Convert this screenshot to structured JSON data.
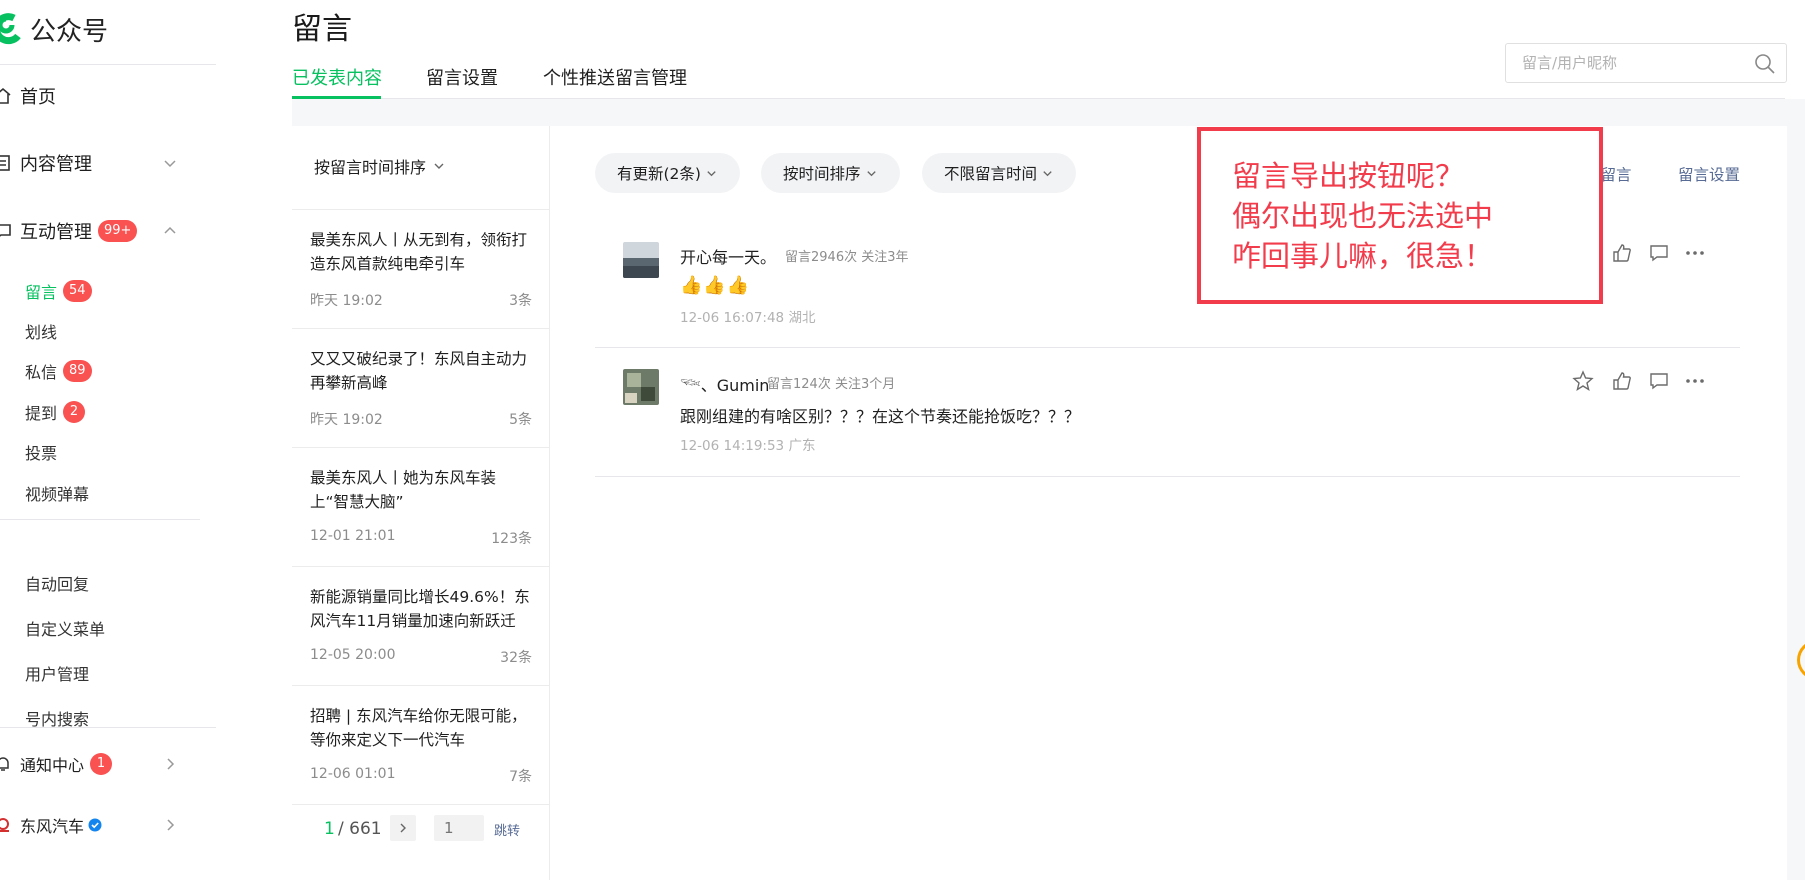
{
  "brand": {
    "name": "公众号"
  },
  "sidebar": {
    "home": "首页",
    "content_mgmt": "内容管理",
    "interaction_mgmt": "互动管理",
    "interaction_badge": "99+",
    "sub_items": [
      {
        "label": "留言",
        "badge": "54"
      },
      {
        "label": "划线"
      },
      {
        "label": "私信",
        "badge": "89"
      },
      {
        "label": "提到",
        "badge": "2"
      },
      {
        "label": "投票"
      },
      {
        "label": "视频弹幕"
      }
    ],
    "tools": [
      "自动回复",
      "自定义菜单",
      "用户管理",
      "号内搜索"
    ],
    "notify": "通知中心",
    "notify_badge": "1",
    "account": "东风汽车"
  },
  "header": {
    "title": "留言",
    "tabs": [
      "已发表内容",
      "留言设置",
      "个性推送留言管理"
    ],
    "search_placeholder": "留言/用户昵称"
  },
  "articles": {
    "sort_label": "按留言时间排序",
    "items": [
      {
        "title": "最美东风人丨从无到有，领衔打造东风首款纯电牵引车",
        "time": "昨天 19:02",
        "count": "3条"
      },
      {
        "title": "又又又破纪录了！东风自主动力再攀新高峰",
        "time": "昨天 19:02",
        "count": "5条"
      },
      {
        "title": "最美东风人丨她为东风车装上“智慧大脑”",
        "time": "12-01 21:01",
        "count": "123条"
      },
      {
        "title": "新能源销量同比增长49.6%！东风汽车11月销量加速向新跃迁",
        "time": "12-05 20:00",
        "count": "32条"
      },
      {
        "title": "招聘 | 东风汽车给你无限可能，等你来定义下一代汽车",
        "time": "12-06 01:01",
        "count": "7条"
      }
    ],
    "pager": {
      "current": "1",
      "total": "/ 661",
      "input_placeholder": "1",
      "jump": "跳转"
    }
  },
  "comments": {
    "filters": [
      "有更新(2条)",
      "按时间排序",
      "不限留言时间"
    ],
    "links": [
      "写留言",
      "留言设置"
    ],
    "items": [
      {
        "name": "开心每一天。",
        "meta": "留言2946次 关注3年",
        "body": "👍👍👍",
        "foot": "12-06 16:07:48 湖北"
      },
      {
        "name": "𓆝、Gumin",
        "meta": "留言124次 关注3个月",
        "body": "跟刚组建的有啥区别？？？在这个节奏还能抢饭吃？？？",
        "foot": "12-06 14:19:53 广东"
      }
    ]
  },
  "annotation": {
    "lines": [
      "留言导出按钮呢？",
      "偶尔出现也无法选中",
      "咋回事儿嘛，很急！"
    ]
  },
  "colors": {
    "accent": "#07c160",
    "badge": "#fa5151",
    "link": "#576b95",
    "annotation": "#f23c4c"
  }
}
